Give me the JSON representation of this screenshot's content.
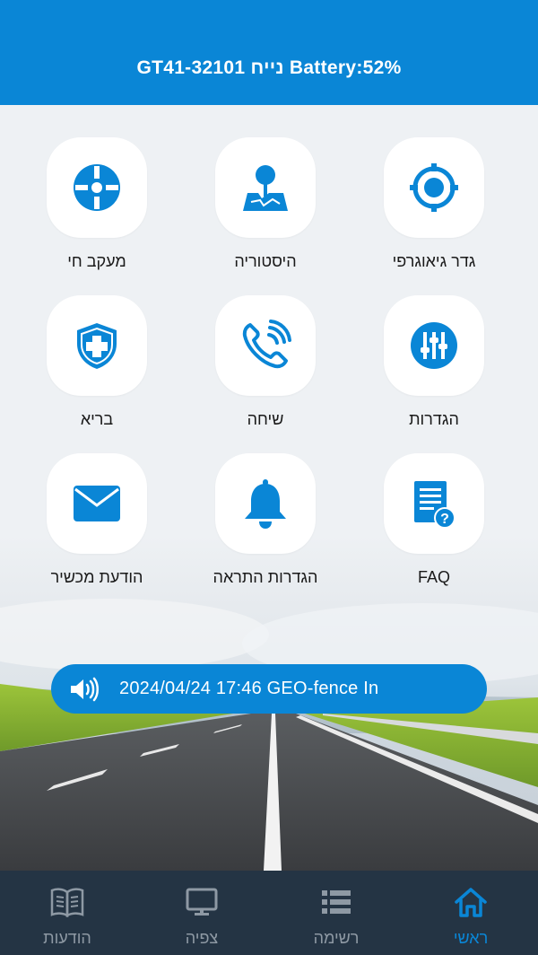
{
  "header": {
    "title": "GT41-32101 נייח Battery:52%"
  },
  "tiles": [
    {
      "label": "גדר גיאוגרפי",
      "icon": "geofence-target-icon"
    },
    {
      "label": "היסטוריה",
      "icon": "map-pin-icon"
    },
    {
      "label": "מעקב חי",
      "icon": "crosshair-icon"
    },
    {
      "label": "הגדרות",
      "icon": "sliders-icon"
    },
    {
      "label": "שיחה",
      "icon": "phone-call-icon"
    },
    {
      "label": "בריא",
      "icon": "health-shield-icon"
    },
    {
      "label": "FAQ",
      "icon": "faq-document-icon"
    },
    {
      "label": "הגדרות התראה",
      "icon": "bell-icon"
    },
    {
      "label": "הודעת מכשיר",
      "icon": "envelope-icon"
    }
  ],
  "notice": {
    "text": "2024/04/24 17:46 GEO-fence In",
    "icon": "speaker-icon"
  },
  "tabs": [
    {
      "label": "הודעות",
      "icon": "book-icon"
    },
    {
      "label": "צפיה",
      "icon": "monitor-icon"
    },
    {
      "label": "רשימה",
      "icon": "list-icon"
    },
    {
      "label": "ראשי",
      "icon": "home-icon",
      "active": true
    }
  ],
  "colors": {
    "primary": "#0a86d6",
    "tabbar": "#243444",
    "tab_inactive": "#8e99a4"
  }
}
